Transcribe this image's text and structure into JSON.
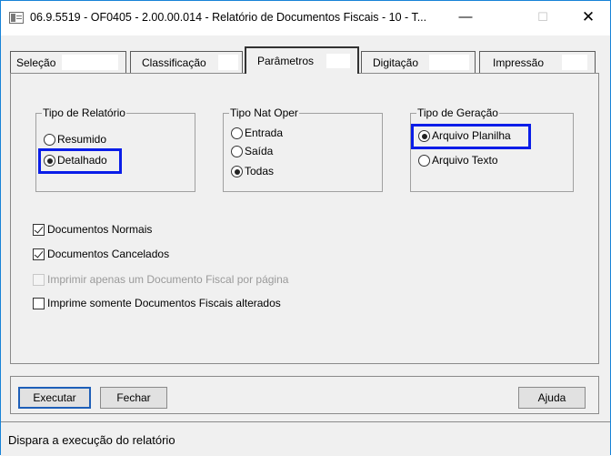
{
  "window": {
    "title": "06.9.5519 - OF0405 - 2.00.00.014 - Relatório de Documentos Fiscais - 10 - T...",
    "icon": "app-window-icon",
    "controls": {
      "minimize": "—",
      "maximize": "☐",
      "close": "✕"
    }
  },
  "tabs": [
    {
      "label": "Seleção",
      "active": false
    },
    {
      "label": "Classificação",
      "active": false
    },
    {
      "label": "Parâmetros",
      "active": true
    },
    {
      "label": "Digitação",
      "active": false
    },
    {
      "label": "Impressão",
      "active": false
    }
  ],
  "groups": {
    "tipo_relatorio": {
      "title": "Tipo de Relatório",
      "options": [
        {
          "label": "Resumido",
          "selected": false
        },
        {
          "label": "Detalhado",
          "selected": true
        }
      ]
    },
    "tipo_nat_oper": {
      "title": "Tipo Nat Oper",
      "options": [
        {
          "label": "Entrada",
          "selected": false
        },
        {
          "label": "Saída",
          "selected": false
        },
        {
          "label": "Todas",
          "selected": true
        }
      ]
    },
    "tipo_geracao": {
      "title": "Tipo de Geração",
      "options": [
        {
          "label": "Arquivo Planilha",
          "selected": true
        },
        {
          "label": "Arquivo Texto",
          "selected": false
        }
      ]
    }
  },
  "checkboxes": [
    {
      "label": "Documentos Normais",
      "checked": true,
      "enabled": true
    },
    {
      "label": "Documentos Cancelados",
      "checked": true,
      "enabled": true
    },
    {
      "label": "Imprimir apenas um Documento Fiscal por página",
      "checked": false,
      "enabled": false
    },
    {
      "label": "Imprime somente Documentos Fiscais alterados",
      "checked": false,
      "enabled": true
    }
  ],
  "buttons": {
    "executar": "Executar",
    "fechar": "Fechar",
    "ajuda": "Ajuda"
  },
  "status": {
    "text": "Dispara a execução do relatório"
  },
  "colors": {
    "highlight": "#0a1de8",
    "window_border": "#1883d7",
    "background": "#f0f0f0"
  }
}
